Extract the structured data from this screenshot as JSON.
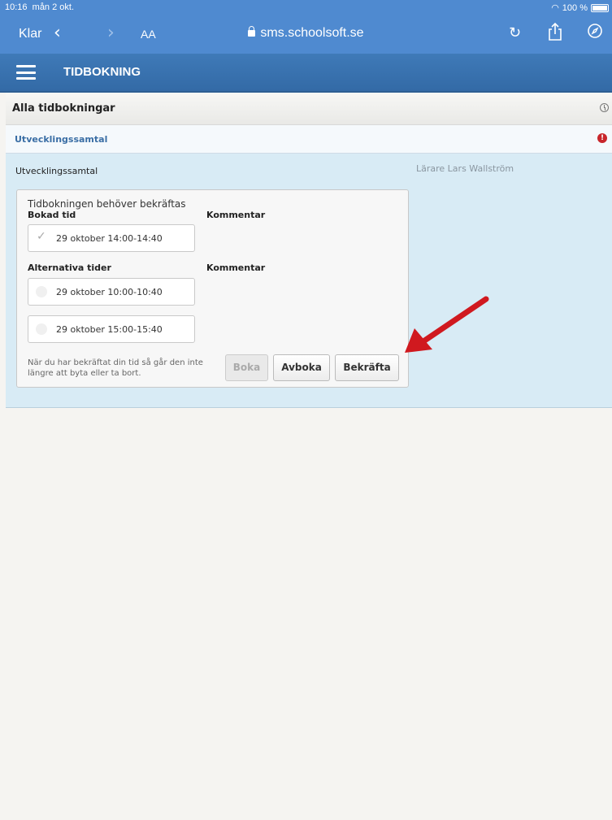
{
  "status_bar": {
    "time": "10:16",
    "date": "mån 2 okt.",
    "battery": "100 %"
  },
  "browser": {
    "done_label": "Klar",
    "text_size_label": "AA",
    "url": "sms.schoolsoft.se",
    "icons": [
      "back-icon",
      "forward-icon",
      "reload-icon",
      "share-icon",
      "compass-icon",
      "lock-icon"
    ]
  },
  "app": {
    "title": "TIDBOKNING"
  },
  "list": {
    "header": "Alla tidbokningar",
    "section_title": "Utvecklingssamtal",
    "alert_glyph": "!"
  },
  "detail": {
    "title": "Utvecklingssamtal",
    "teacher": "Lärare Lars Wallström",
    "needs_confirmation": "Tidbokningen behöver bekräftas",
    "booked_label": "Bokad tid",
    "comment_label": "Kommentar",
    "alt_label": "Alternativa tider",
    "booked_slot": "29 oktober 14:00-14:40",
    "alternatives": [
      "29 oktober 10:00-10:40",
      "29 oktober 15:00-15:40"
    ],
    "note": "När du har bekräftat din tid så går den inte längre att byta eller ta bort.",
    "buttons": {
      "book": "Boka",
      "cancel": "Avboka",
      "confirm": "Bekräfta"
    }
  },
  "colors": {
    "browser_bar": "#4f8ad0",
    "app_header": "#3a74b2",
    "detail_bg": "#d8ebf5",
    "arrow": "#d0191f"
  }
}
